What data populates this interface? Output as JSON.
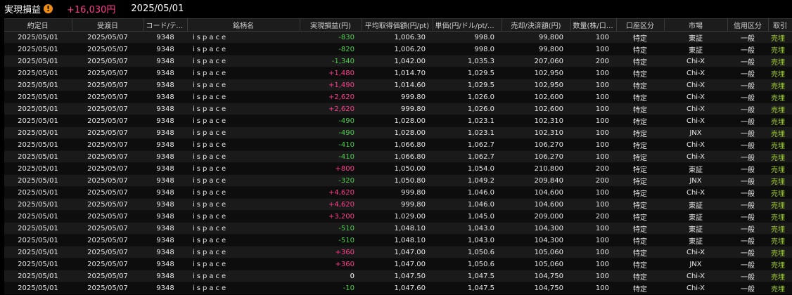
{
  "header": {
    "title": "実現損益",
    "total": "+16,030円",
    "date": "2025/05/01",
    "warn_glyph": "!"
  },
  "colors": {
    "positive": "#ff3c8c",
    "negative": "#4ccc4c",
    "trade": "#a0d02a",
    "warn": "#f08c14"
  },
  "columns": [
    "約定日",
    "受渡日",
    "コード/ティッ...",
    "銘柄名",
    "実現損益(円)",
    "平均取得価額(円/pt)",
    "単価(円/ドル/pt/セ...",
    "売却/決済額(円)",
    "数量(株/口/枚)",
    "口座区分",
    "市場",
    "信用区分",
    "取引"
  ],
  "rows": [
    {
      "trade_date": "2025/05/01",
      "settle_date": "2025/05/07",
      "code": "9348",
      "name": "ispace",
      "pl": "-830",
      "pl_sign": "neg",
      "avg": "1,006.30",
      "price": "998.0",
      "amount": "99,800",
      "qty": "100",
      "account": "特定",
      "market": "東証",
      "credit": "一般",
      "trade": "売埋"
    },
    {
      "trade_date": "2025/05/01",
      "settle_date": "2025/05/07",
      "code": "9348",
      "name": "ispace",
      "pl": "-820",
      "pl_sign": "neg",
      "avg": "1,006.20",
      "price": "998.0",
      "amount": "99,800",
      "qty": "100",
      "account": "特定",
      "market": "東証",
      "credit": "一般",
      "trade": "売埋"
    },
    {
      "trade_date": "2025/05/01",
      "settle_date": "2025/05/07",
      "code": "9348",
      "name": "ispace",
      "pl": "-1,340",
      "pl_sign": "neg",
      "avg": "1,042.00",
      "price": "1,035.3",
      "amount": "207,060",
      "qty": "200",
      "account": "特定",
      "market": "Chi-X",
      "credit": "一般",
      "trade": "売埋"
    },
    {
      "trade_date": "2025/05/01",
      "settle_date": "2025/05/07",
      "code": "9348",
      "name": "ispace",
      "pl": "+1,480",
      "pl_sign": "pos",
      "avg": "1,014.70",
      "price": "1,029.5",
      "amount": "102,950",
      "qty": "100",
      "account": "特定",
      "market": "Chi-X",
      "credit": "一般",
      "trade": "売埋"
    },
    {
      "trade_date": "2025/05/01",
      "settle_date": "2025/05/07",
      "code": "9348",
      "name": "ispace",
      "pl": "+1,490",
      "pl_sign": "pos",
      "avg": "1,014.60",
      "price": "1,029.5",
      "amount": "102,950",
      "qty": "100",
      "account": "特定",
      "market": "Chi-X",
      "credit": "一般",
      "trade": "売埋"
    },
    {
      "trade_date": "2025/05/01",
      "settle_date": "2025/05/07",
      "code": "9348",
      "name": "ispace",
      "pl": "+2,620",
      "pl_sign": "pos",
      "avg": "999.80",
      "price": "1,026.0",
      "amount": "102,600",
      "qty": "100",
      "account": "特定",
      "market": "Chi-X",
      "credit": "一般",
      "trade": "売埋"
    },
    {
      "trade_date": "2025/05/01",
      "settle_date": "2025/05/07",
      "code": "9348",
      "name": "ispace",
      "pl": "+2,620",
      "pl_sign": "pos",
      "avg": "999.80",
      "price": "1,026.0",
      "amount": "102,600",
      "qty": "100",
      "account": "特定",
      "market": "Chi-X",
      "credit": "一般",
      "trade": "売埋"
    },
    {
      "trade_date": "2025/05/01",
      "settle_date": "2025/05/07",
      "code": "9348",
      "name": "ispace",
      "pl": "-490",
      "pl_sign": "neg",
      "avg": "1,028.00",
      "price": "1,023.1",
      "amount": "102,310",
      "qty": "100",
      "account": "特定",
      "market": "Chi-X",
      "credit": "一般",
      "trade": "売埋"
    },
    {
      "trade_date": "2025/05/01",
      "settle_date": "2025/05/07",
      "code": "9348",
      "name": "ispace",
      "pl": "-490",
      "pl_sign": "neg",
      "avg": "1,028.00",
      "price": "1,023.1",
      "amount": "102,310",
      "qty": "100",
      "account": "特定",
      "market": "JNX",
      "credit": "一般",
      "trade": "売埋"
    },
    {
      "trade_date": "2025/05/01",
      "settle_date": "2025/05/07",
      "code": "9348",
      "name": "ispace",
      "pl": "-410",
      "pl_sign": "neg",
      "avg": "1,066.80",
      "price": "1,062.7",
      "amount": "106,270",
      "qty": "100",
      "account": "特定",
      "market": "Chi-X",
      "credit": "一般",
      "trade": "売埋"
    },
    {
      "trade_date": "2025/05/01",
      "settle_date": "2025/05/07",
      "code": "9348",
      "name": "ispace",
      "pl": "-410",
      "pl_sign": "neg",
      "avg": "1,066.80",
      "price": "1,062.7",
      "amount": "106,270",
      "qty": "100",
      "account": "特定",
      "market": "Chi-X",
      "credit": "一般",
      "trade": "売埋"
    },
    {
      "trade_date": "2025/05/01",
      "settle_date": "2025/05/07",
      "code": "9348",
      "name": "ispace",
      "pl": "+800",
      "pl_sign": "pos",
      "avg": "1,050.00",
      "price": "1,054.0",
      "amount": "210,800",
      "qty": "200",
      "account": "特定",
      "market": "東証",
      "credit": "一般",
      "trade": "売埋"
    },
    {
      "trade_date": "2025/05/01",
      "settle_date": "2025/05/07",
      "code": "9348",
      "name": "ispace",
      "pl": "-320",
      "pl_sign": "neg",
      "avg": "1,050.80",
      "price": "1,049.2",
      "amount": "209,840",
      "qty": "200",
      "account": "特定",
      "market": "JNX",
      "credit": "一般",
      "trade": "売埋"
    },
    {
      "trade_date": "2025/05/01",
      "settle_date": "2025/05/07",
      "code": "9348",
      "name": "ispace",
      "pl": "+4,620",
      "pl_sign": "pos",
      "avg": "999.80",
      "price": "1,046.0",
      "amount": "104,600",
      "qty": "100",
      "account": "特定",
      "market": "Chi-X",
      "credit": "一般",
      "trade": "売埋"
    },
    {
      "trade_date": "2025/05/01",
      "settle_date": "2025/05/07",
      "code": "9348",
      "name": "ispace",
      "pl": "+4,620",
      "pl_sign": "pos",
      "avg": "999.80",
      "price": "1,046.0",
      "amount": "104,600",
      "qty": "100",
      "account": "特定",
      "market": "東証",
      "credit": "一般",
      "trade": "売埋"
    },
    {
      "trade_date": "2025/05/01",
      "settle_date": "2025/05/07",
      "code": "9348",
      "name": "ispace",
      "pl": "+3,200",
      "pl_sign": "pos",
      "avg": "1,029.00",
      "price": "1,045.0",
      "amount": "209,000",
      "qty": "200",
      "account": "特定",
      "market": "東証",
      "credit": "一般",
      "trade": "売埋"
    },
    {
      "trade_date": "2025/05/01",
      "settle_date": "2025/05/07",
      "code": "9348",
      "name": "ispace",
      "pl": "-510",
      "pl_sign": "neg",
      "avg": "1,048.10",
      "price": "1,043.0",
      "amount": "104,300",
      "qty": "100",
      "account": "特定",
      "market": "東証",
      "credit": "一般",
      "trade": "売埋"
    },
    {
      "trade_date": "2025/05/01",
      "settle_date": "2025/05/07",
      "code": "9348",
      "name": "ispace",
      "pl": "-510",
      "pl_sign": "neg",
      "avg": "1,048.10",
      "price": "1,043.0",
      "amount": "104,300",
      "qty": "100",
      "account": "特定",
      "market": "東証",
      "credit": "一般",
      "trade": "売埋"
    },
    {
      "trade_date": "2025/05/01",
      "settle_date": "2025/05/07",
      "code": "9348",
      "name": "ispace",
      "pl": "+360",
      "pl_sign": "pos",
      "avg": "1,047.00",
      "price": "1,050.6",
      "amount": "105,060",
      "qty": "100",
      "account": "特定",
      "market": "Chi-X",
      "credit": "一般",
      "trade": "売埋"
    },
    {
      "trade_date": "2025/05/01",
      "settle_date": "2025/05/07",
      "code": "9348",
      "name": "ispace",
      "pl": "+360",
      "pl_sign": "pos",
      "avg": "1,047.00",
      "price": "1,050.6",
      "amount": "105,060",
      "qty": "100",
      "account": "特定",
      "market": "JNX",
      "credit": "一般",
      "trade": "売埋"
    },
    {
      "trade_date": "2025/05/01",
      "settle_date": "2025/05/07",
      "code": "9348",
      "name": "ispace",
      "pl": "0",
      "pl_sign": "zero",
      "avg": "1,047.50",
      "price": "1,047.5",
      "amount": "104,750",
      "qty": "100",
      "account": "特定",
      "market": "Chi-X",
      "credit": "一般",
      "trade": "売埋"
    },
    {
      "trade_date": "2025/05/01",
      "settle_date": "2025/05/07",
      "code": "9348",
      "name": "ispace",
      "pl": "-10",
      "pl_sign": "neg",
      "avg": "1,047.60",
      "price": "1,047.5",
      "amount": "104,750",
      "qty": "100",
      "account": "特定",
      "market": "Chi-X",
      "credit": "一般",
      "trade": "売埋"
    }
  ]
}
